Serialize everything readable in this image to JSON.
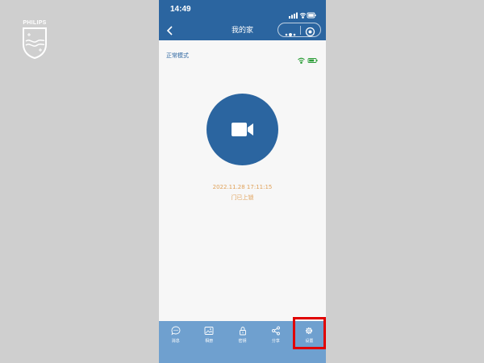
{
  "brand": {
    "name": "PHILIPS"
  },
  "status_bar": {
    "time": "14:49"
  },
  "nav": {
    "title": "我的家"
  },
  "device": {
    "mode": "正常模式",
    "event_time": "2022.11.28 17:11:15",
    "event_desc": "门已上锁"
  },
  "tabs": [
    {
      "label": "消息",
      "icon": "message-icon"
    },
    {
      "label": "相册",
      "icon": "image-icon"
    },
    {
      "label": "密钥",
      "icon": "lock-icon"
    },
    {
      "label": "分享",
      "icon": "share-icon"
    },
    {
      "label": "设置",
      "icon": "gear-icon"
    }
  ],
  "colors": {
    "primary": "#2b65a0",
    "tabbar": "#6fa0cf",
    "event_text": "#e0a25a",
    "highlight": "#e00000",
    "battery": "#2e9e3a"
  }
}
